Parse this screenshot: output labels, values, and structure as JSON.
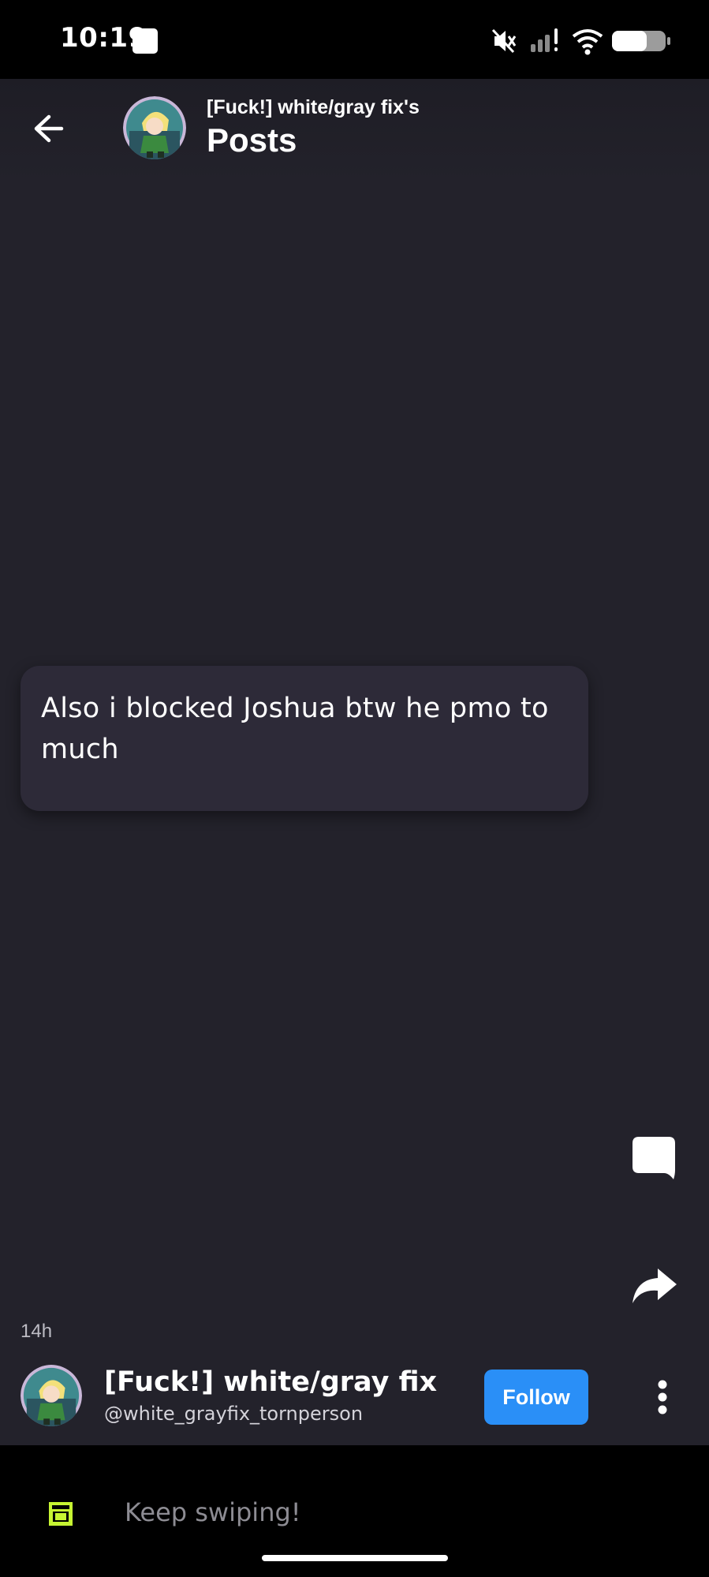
{
  "status_bar": {
    "time": "10:19",
    "icons": [
      "notification-square-icon",
      "mute-icon",
      "signal-icon",
      "wifi-icon",
      "battery-icon"
    ]
  },
  "header": {
    "subtitle": "[Fuck!] white/gray fix's",
    "title": "Posts"
  },
  "post": {
    "text": "Also i blocked Joshua btw he pmo to much",
    "time_ago": "14h"
  },
  "author": {
    "name": "[Fuck!] white/gray fix",
    "handle": "@white_grayfix_tornperson",
    "follow_label": "Follow"
  },
  "bottom_bar": {
    "placeholder": "Keep swiping!"
  },
  "colors": {
    "background": "#23222b",
    "card": "#2d2a38",
    "follow": "#2a8ff7",
    "accent": "#c6f432"
  }
}
